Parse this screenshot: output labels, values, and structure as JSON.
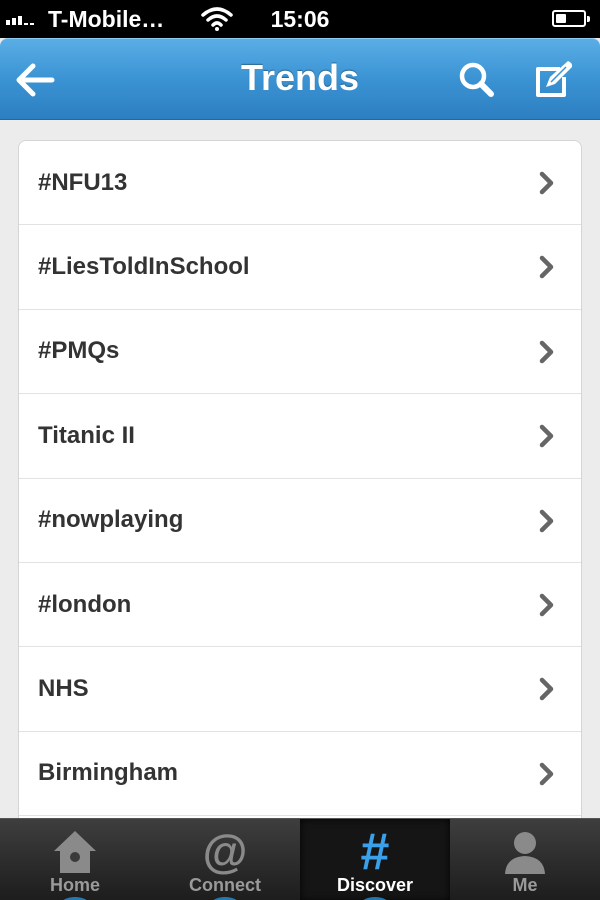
{
  "status_bar": {
    "carrier": "T-Mobile…",
    "time": "15:06",
    "battery_level": 0.4
  },
  "nav_bar": {
    "title": "Trends",
    "back_icon": "back-arrow-icon",
    "search_icon": "search-icon",
    "compose_icon": "compose-icon",
    "color": "#3b93d3"
  },
  "trends": [
    {
      "label": "#NFU13"
    },
    {
      "label": "#LiesToldInSchool"
    },
    {
      "label": "#PMQs"
    },
    {
      "label": "Titanic II"
    },
    {
      "label": "#nowplaying"
    },
    {
      "label": "#london"
    },
    {
      "label": "NHS"
    },
    {
      "label": "Birmingham"
    }
  ],
  "tab_bar": {
    "tabs": [
      {
        "label": "Home",
        "icon": "home-icon",
        "active": false
      },
      {
        "label": "Connect",
        "icon": "at-icon",
        "active": false
      },
      {
        "label": "Discover",
        "icon": "hashtag-icon",
        "active": true
      },
      {
        "label": "Me",
        "icon": "person-icon",
        "active": false
      }
    ]
  }
}
